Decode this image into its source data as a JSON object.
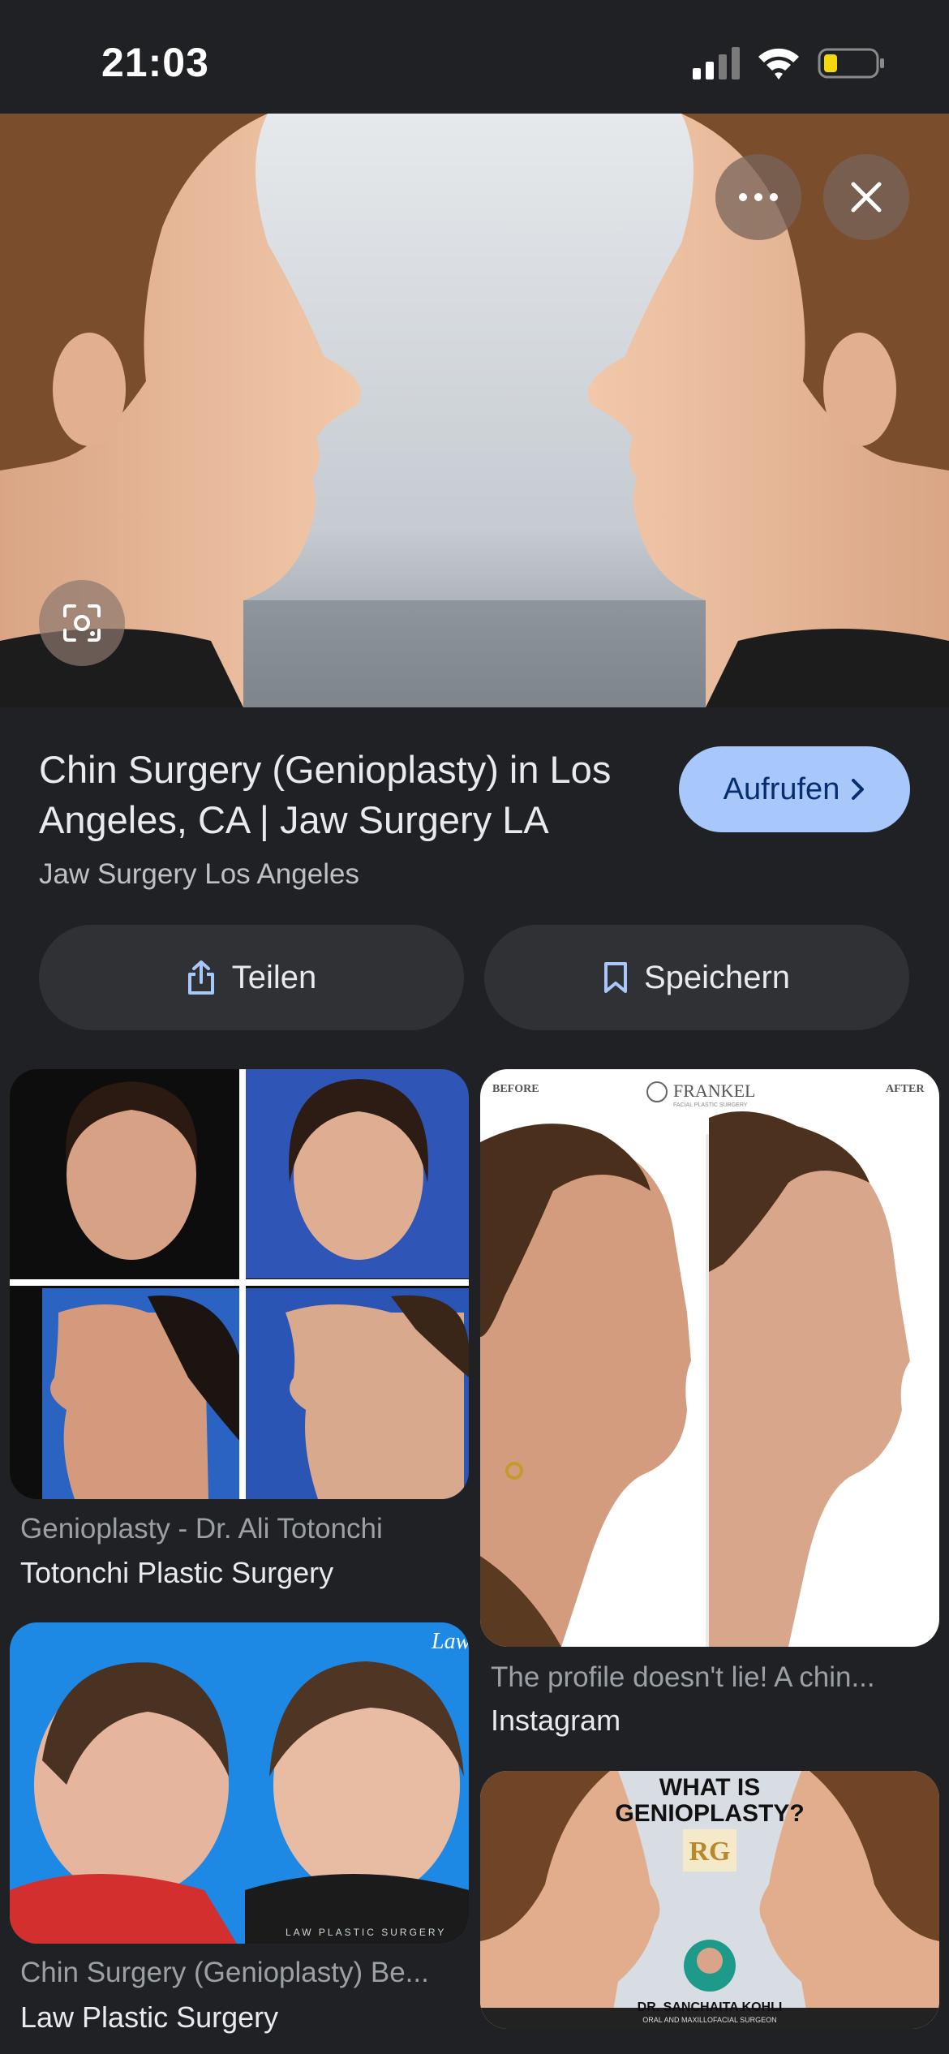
{
  "status_bar": {
    "time": "21:03"
  },
  "result": {
    "title": "Chin Surgery (Genioplasty) in Los Angeles, CA | Jaw Surgery LA",
    "source": "Jaw Surgery Los Angeles",
    "visit_label": "Aufrufen",
    "share_label": "Teilen",
    "save_label": "Speichern"
  },
  "cards": [
    {
      "caption": "Genioplasty - Dr. Ali Totonchi",
      "site": "Totonchi Plastic Surgery"
    },
    {
      "caption": "The profile doesn't lie! A chin...",
      "site": "Instagram",
      "overlay_before": "BEFORE",
      "overlay_after": "AFTER",
      "overlay_brand": "FRANKEL",
      "overlay_sub": "FACIAL PLASTIC SURGERY"
    },
    {
      "caption": "Chin Surgery (Genioplasty) Be...",
      "site": "Law Plastic Surgery",
      "overlay_brand": "Law",
      "overlay_sub": "LAW PLASTIC SURGERY"
    },
    {
      "overlay_title_1": "WHAT IS",
      "overlay_title_2": "GENIOPLASTY?",
      "overlay_brand": "RG",
      "overlay_name": "DR. SANCHAITA KOHLI",
      "overlay_role": "ORAL AND MAXILLOFACIAL SURGEON"
    }
  ],
  "colors": {
    "background": "#202124",
    "accent_button": "#a8c7fa",
    "pill_button": "#303134"
  },
  "icons": [
    "signal-icon",
    "wifi-icon",
    "battery-icon",
    "more-icon",
    "close-icon",
    "lens-icon",
    "chevron-right-icon",
    "share-icon",
    "bookmark-icon"
  ]
}
